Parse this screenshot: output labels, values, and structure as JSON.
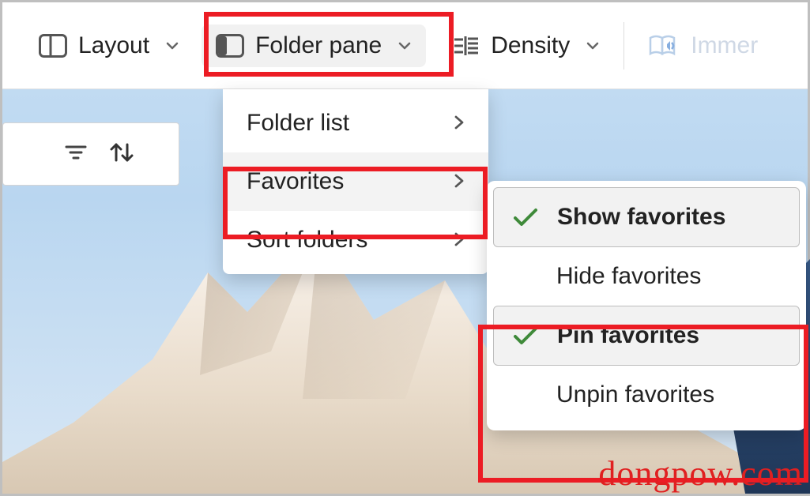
{
  "ribbon": {
    "layout": {
      "label": "Layout"
    },
    "folder": {
      "label": "Folder pane"
    },
    "density": {
      "label": "Density"
    },
    "immersive": {
      "label": "Immer"
    }
  },
  "menu1": {
    "folder_list": "Folder list",
    "favorites": "Favorites",
    "sort": "Sort folders"
  },
  "menu2": {
    "show": "Show favorites",
    "hide": "Hide favorites",
    "pin": "Pin favorites",
    "unpin": "Unpin favorites"
  },
  "watermark": "dongpow.com",
  "colors": {
    "highlight": "#ec1c24",
    "check": "#3f8a3a",
    "accent": "#7fa9d8"
  }
}
